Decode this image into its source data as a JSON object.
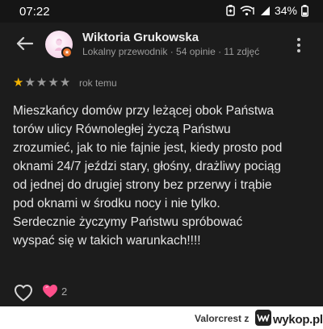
{
  "status_bar": {
    "time": "07:22",
    "battery": "34%"
  },
  "reviewer": {
    "name": "Wiktoria Grukowska",
    "meta": "Lokalny przewodnik · 54 opinie · 11 zdjęć"
  },
  "review": {
    "rating": 1,
    "max_rating": 5,
    "date": "rok temu",
    "lines": [
      "Mieszkańcy domów przy leżącej obok Państwa",
      "torów ulicy Równoległej życzą Państwu",
      "zrozumieć, jak to nie fajnie jest, kiedy prosto pod",
      "oknami 24/7 jeździ stary, głośny, drażliwy pociąg",
      "od jednej do drugiej strony bez przerwy i trąbie",
      "pod oknami w środku nocy i nie tylko.",
      "Serdecznie życzymy Państwu spróbować",
      "wyspać się w takich warunkach!!!!"
    ]
  },
  "reactions": {
    "heart_count": "2"
  },
  "footer": {
    "username": "Valorcrest z",
    "logo_text": "wykop.pl"
  },
  "colors": {
    "star": "#f5b400",
    "badge": "#e8732b",
    "heart": "#ff4f8b",
    "background": "#1c1c1c"
  }
}
